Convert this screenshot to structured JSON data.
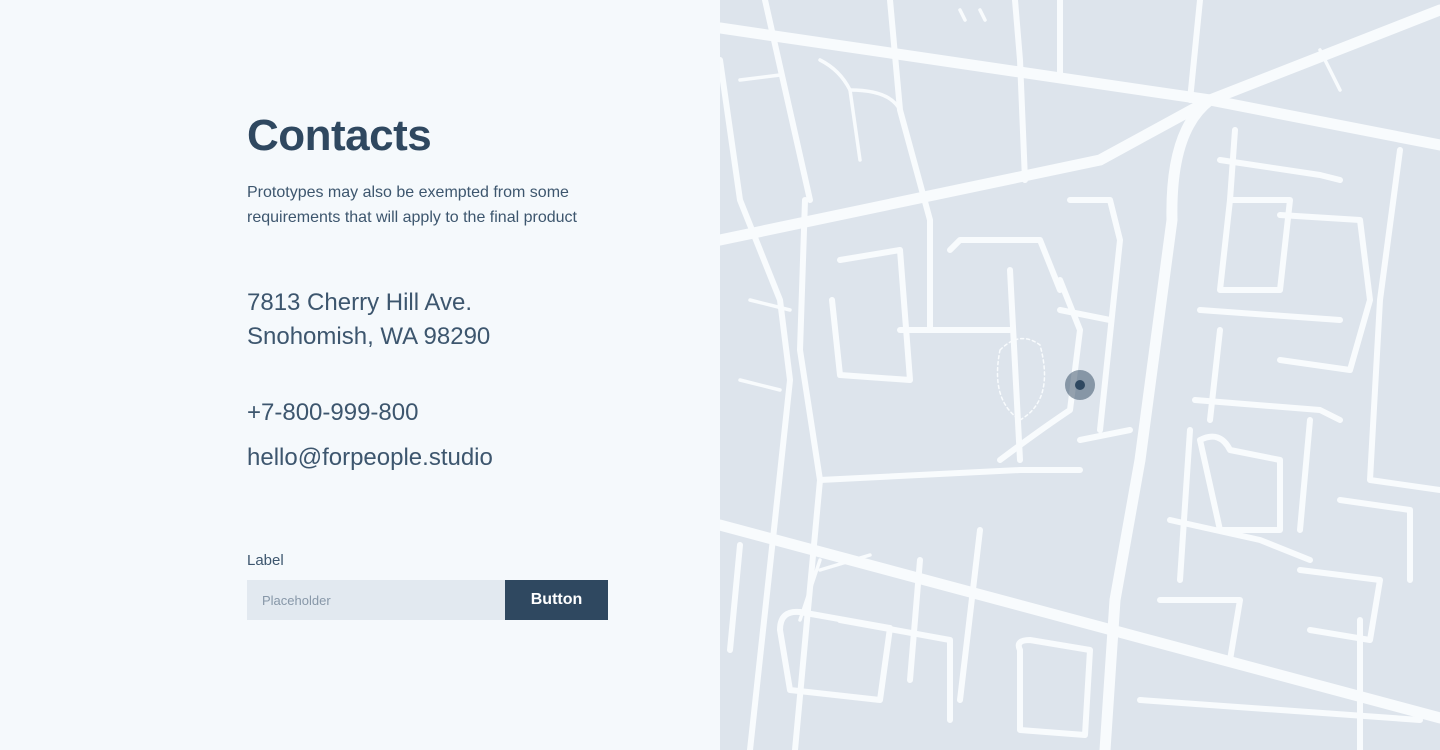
{
  "contacts": {
    "title": "Contacts",
    "description": "Prototypes may also be exempted from some requirements that will apply to the final product",
    "address_line1": "7813 Cherry Hill Ave.",
    "address_line2": "Snohomish, WA 98290",
    "phone": "+7-800-999-800",
    "email": "hello@forpeople.studio"
  },
  "form": {
    "label": "Label",
    "placeholder": "Placeholder",
    "button_label": "Button"
  },
  "map": {
    "background_color": "#dde4ec",
    "road_color": "#f8fbfd",
    "marker_color": "#2f4860",
    "marker_icon": "location-pin-icon"
  }
}
